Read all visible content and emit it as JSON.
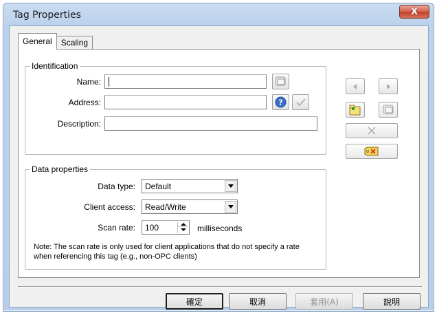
{
  "window": {
    "title": "Tag Properties",
    "close_label": "X"
  },
  "tabs": [
    {
      "label": "General"
    },
    {
      "label": "Scaling"
    }
  ],
  "identification": {
    "group_label": "Identification",
    "name_label": "Name:",
    "name_value": "",
    "address_label": "Address:",
    "address_value": "",
    "description_label": "Description:",
    "description_value": ""
  },
  "data_properties": {
    "group_label": "Data properties",
    "data_type_label": "Data type:",
    "data_type_value": "Default",
    "client_access_label": "Client access:",
    "client_access_value": "Read/Write",
    "scan_rate_label": "Scan rate:",
    "scan_rate_value": "100",
    "scan_rate_unit": "milliseconds",
    "note": "Note: The scan rate is only used for client applications that do not specify a rate when referencing this tag (e.g., non-OPC clients)"
  },
  "side_buttons": {
    "prev_icon": "left-arrow-icon",
    "next_icon": "right-arrow-icon",
    "new_tag_icon": "new-tag-icon",
    "duplicate_icon": "duplicate-tag-icon",
    "delete_icon": "delete-icon",
    "tag_browser_icon": "tag-browser-icon"
  },
  "buttons": {
    "ok": "確定",
    "cancel": "取消",
    "apply": "套用(A)",
    "help": "說明"
  }
}
